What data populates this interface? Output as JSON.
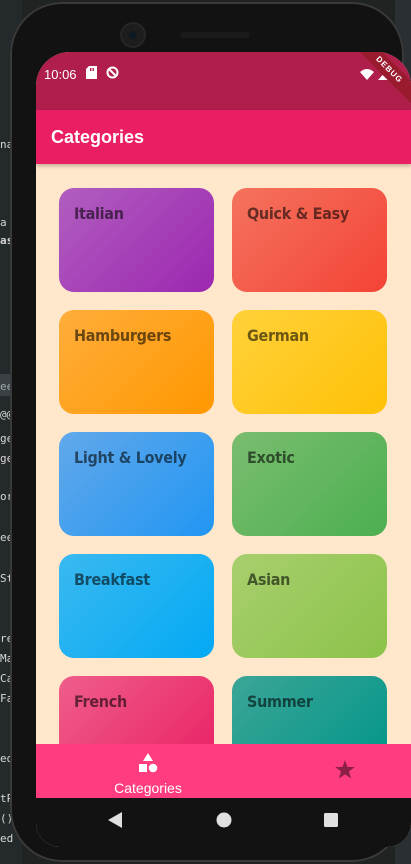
{
  "background_ide": {
    "fragments": [
      "na",
      "a",
      "as",
      "ee",
      "@@",
      "ge",
      "ge",
      "or",
      "ee",
      "St",
      "re",
      "Ma",
      "Ca",
      "Fa",
      "ed",
      "tP",
      "()",
      "ed"
    ]
  },
  "status_bar": {
    "time": "10:06",
    "debug_badge": "DEBUG"
  },
  "app_bar": {
    "title": "Categories"
  },
  "categories": [
    {
      "label": "Italian",
      "color": "#9c27b0"
    },
    {
      "label": "Quick & Easy",
      "color": "#f44336"
    },
    {
      "label": "Hamburgers",
      "color": "#ff9800"
    },
    {
      "label": "German",
      "color": "#ffc107"
    },
    {
      "label": "Light & Lovely",
      "color": "#2196f3"
    },
    {
      "label": "Exotic",
      "color": "#4caf50"
    },
    {
      "label": "Breakfast",
      "color": "#03a9f4"
    },
    {
      "label": "Asian",
      "color": "#8bc34a"
    },
    {
      "label": "French",
      "color": "#e91e63"
    },
    {
      "label": "Summer",
      "color": "#009688"
    }
  ],
  "bottom_nav": {
    "items": [
      {
        "label": "Categories",
        "icon": "category-icon",
        "active": true
      },
      {
        "label": "",
        "icon": "star-icon",
        "active": false
      }
    ]
  },
  "colors": {
    "status_bar": "#b01e4c",
    "app_bar": "#e91e63",
    "screen_background": "#ffe7cc",
    "bottom_nav": "#ff3c7f"
  }
}
